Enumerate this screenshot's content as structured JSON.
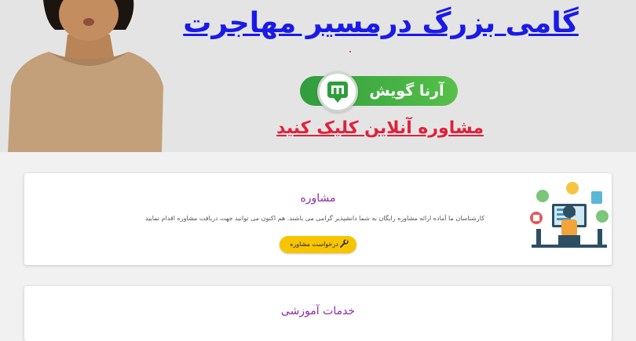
{
  "banner": {
    "headline": "گامی بزرگ درمسیر مهاجرت",
    "brand_name": "آرنا گویش",
    "cta": "مشاوره آنلاین کلیک کنید"
  },
  "consult_card": {
    "title": "مشاوره",
    "description": "کارشناسان ما آماده ارائه مشاوره رایگان به شما دانشپذیر گرامی می باشند. هم اکنون می توانید جهت دریافت مشاوره اقدام نمایید",
    "button_label": "درخواست مشاوره",
    "button_icon": "wrench-icon"
  },
  "education_card": {
    "title": "خدمات آموزشی"
  },
  "colors": {
    "headline_blue": "#1a1ae8",
    "cta_red": "#e0203a",
    "brand_green": "#3aa83f",
    "title_purple": "#8e2aa5",
    "button_yellow": "#f7c500"
  }
}
